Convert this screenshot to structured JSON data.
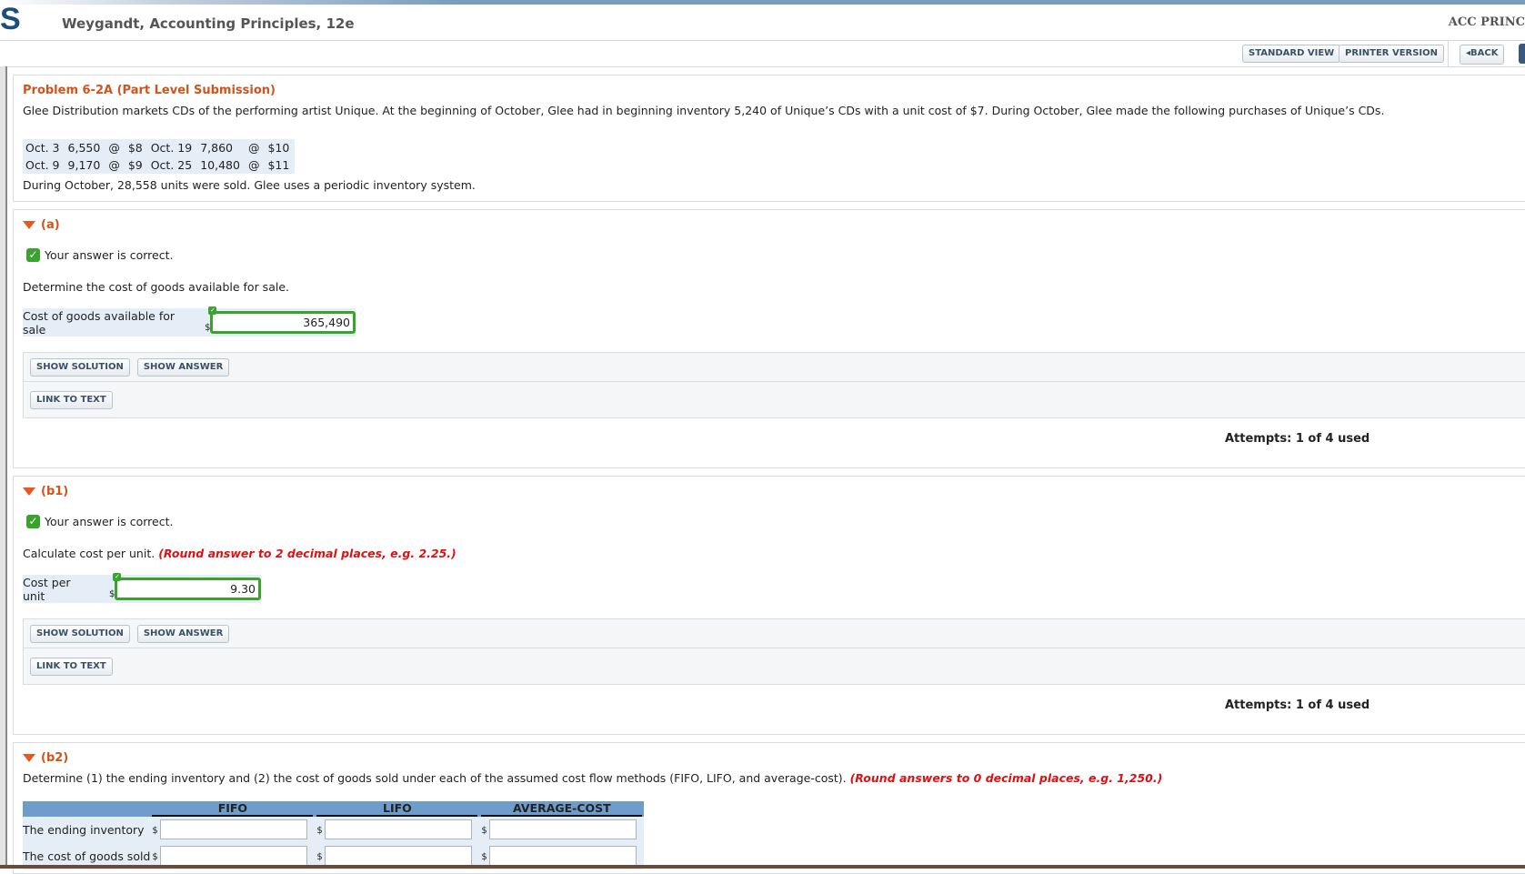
{
  "header": {
    "logo": "S",
    "title": "Weygandt, Accounting Principles, 12e",
    "course": "ACC PRINC"
  },
  "toolbar": {
    "standard_view": "STANDARD VIEW",
    "printer_version": "PRINTER VERSION",
    "back": "◂BACK"
  },
  "problem": {
    "title": "Problem 6-2A (Part Level Submission)",
    "intro": "Glee Distribution markets CDs of the performing artist Unique. At the beginning of October, Glee had in beginning inventory 5,240 of Unique’s CDs with a unit cost of $7. During October, Glee made the following purchases of Unique’s CDs.",
    "purchases": [
      [
        "Oct. 3",
        "6,550",
        "@",
        "$8",
        "Oct. 19",
        "7,860",
        "@",
        "$10"
      ],
      [
        "Oct. 9",
        "9,170",
        "@",
        "$9",
        "Oct. 25",
        "10,480",
        "@",
        "$11"
      ]
    ],
    "sold_text": "During October, 28,558 units were sold. Glee uses a periodic inventory system."
  },
  "parts": {
    "a": {
      "label": "(a)",
      "status": "Your answer is correct.",
      "instruction": "Determine the cost of goods available for sale.",
      "field_label": "Cost of goods available for sale",
      "currency": "$",
      "value": "365,490",
      "show_solution": "SHOW SOLUTION",
      "show_answer": "SHOW ANSWER",
      "link_to_text": "LINK TO TEXT",
      "attempts": "Attempts: 1 of 4 used"
    },
    "b1": {
      "label": "(b1)",
      "status": "Your answer is correct.",
      "instruction": "Calculate cost per unit.",
      "hint": "(Round answer to 2 decimal places, e.g. 2.25.)",
      "field_label": "Cost per unit",
      "currency": "$",
      "value": "9.30",
      "show_solution": "SHOW SOLUTION",
      "show_answer": "SHOW ANSWER",
      "link_to_text": "LINK TO TEXT",
      "attempts": "Attempts: 1 of 4 used"
    },
    "b2": {
      "label": "(b2)",
      "instruction": "Determine (1) the ending inventory and (2) the cost of goods sold under each of the assumed cost flow methods (FIFO, LIFO, and average-cost).",
      "hint": "(Round answers to 0 decimal places, e.g. 1,250.)",
      "columns": [
        "FIFO",
        "LIFO",
        "AVERAGE-COST"
      ],
      "rows": [
        "The ending inventory",
        "The cost of goods sold"
      ],
      "currency": "$"
    }
  },
  "colors": {
    "accent": "#d2531b",
    "correct": "#3aa32e",
    "table_header": "#6f9dcb",
    "hint": "#dd1111"
  }
}
